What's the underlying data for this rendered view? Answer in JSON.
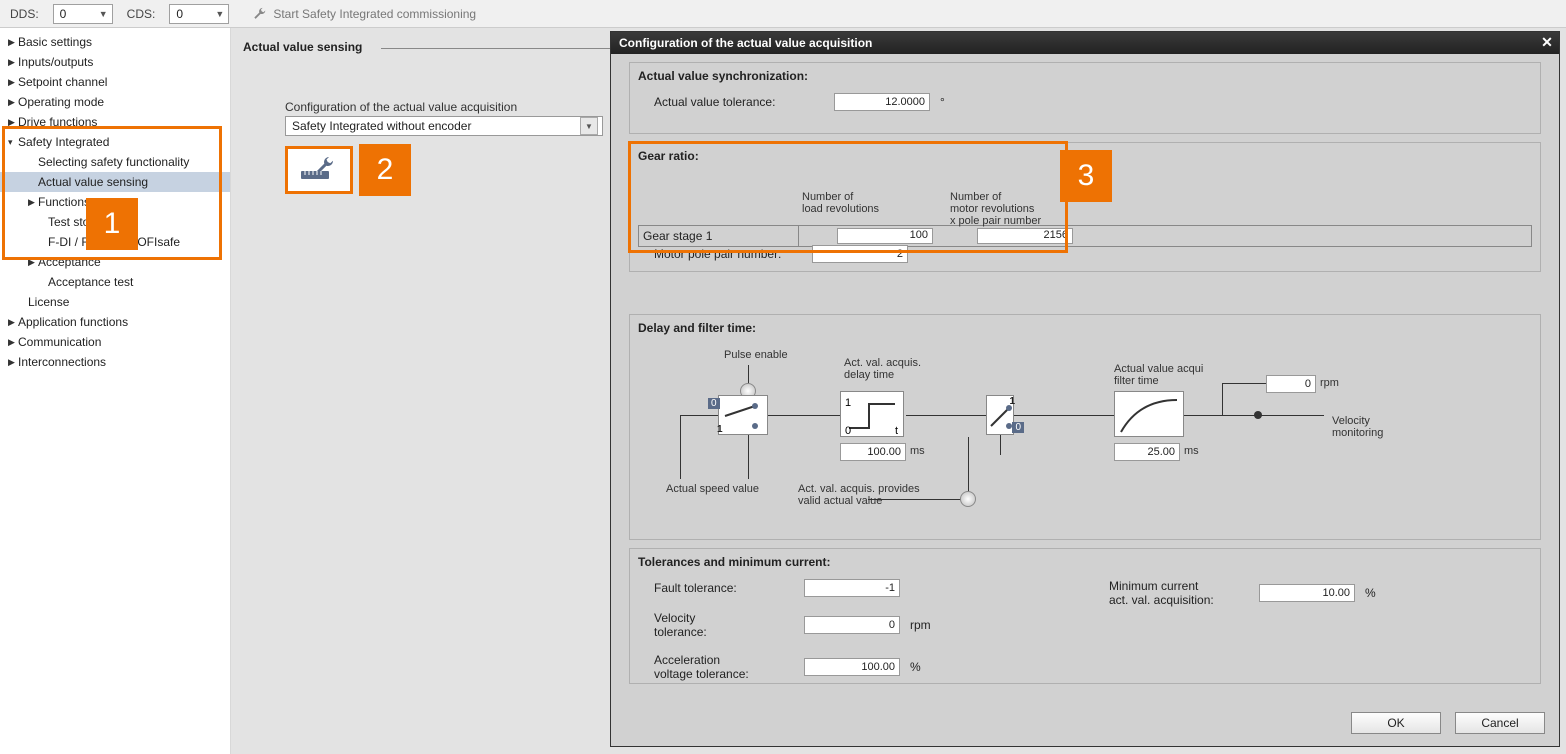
{
  "toolbar": {
    "dds_label": "DDS:",
    "dds_value": "0",
    "cds_label": "CDS:",
    "cds_value": "0",
    "commission": "Start Safety Integrated commissioning"
  },
  "nav": {
    "items": [
      {
        "label": "Basic settings",
        "expand": "▶"
      },
      {
        "label": "Inputs/outputs",
        "expand": "▶"
      },
      {
        "label": "Setpoint channel",
        "expand": "▶"
      },
      {
        "label": "Operating mode",
        "expand": "▶"
      },
      {
        "label": "Drive functions",
        "expand": "▶"
      },
      {
        "label": "Safety Integrated",
        "expand": "▾"
      },
      {
        "label": "Selecting safety functionality",
        "expand": ""
      },
      {
        "label": "Actual value sensing",
        "expand": ""
      },
      {
        "label": "Functions",
        "expand": "▶"
      },
      {
        "label": "Test stop",
        "expand": ""
      },
      {
        "label": "F-DI / F-DO / PROFIsafe",
        "expand": ""
      },
      {
        "label": "Acceptance",
        "expand": "▶"
      },
      {
        "label": "Acceptance test",
        "expand": ""
      },
      {
        "label": "License",
        "expand": ""
      },
      {
        "label": "Application functions",
        "expand": "▶"
      },
      {
        "label": "Communication",
        "expand": "▶"
      },
      {
        "label": "Interconnections",
        "expand": "▶"
      }
    ]
  },
  "center": {
    "title": "Actual value sensing",
    "cfg_label": "Configuration of the actual value acquisition",
    "cfg_value": "Safety Integrated without encoder"
  },
  "callouts": {
    "c1": "1",
    "c2": "2",
    "c3": "3"
  },
  "dialog": {
    "title": "Configuration of the actual value acquisition",
    "sync": {
      "title": "Actual value synchronization:",
      "tolerance_label": "Actual value tolerance:",
      "tolerance_value": "12.0000",
      "tolerance_unit": "°"
    },
    "gear": {
      "title": "Gear ratio:",
      "h_load": "Number of\nload revolutions",
      "h_motor": "Number of\nmotor revolutions\nx pole pair number",
      "row_label": "Gear stage 1",
      "load_val": "100",
      "motor_val": "2156",
      "pp_label": "Motor pole pair number:",
      "pp_val": "2"
    },
    "delay": {
      "title": "Delay and filter time:",
      "pulse_enable": "Pulse enable",
      "delay_label": "Act. val. acquis.\ndelay time",
      "delay_val": "100.00",
      "delay_unit": "ms",
      "filter_label": "Actual value acqui\nfilter time",
      "filter_val": "25.00",
      "filter_unit": "ms",
      "rpm_val": "0",
      "rpm_unit": "rpm",
      "speed_label": "Actual speed value",
      "valid_label": "Act. val. acquis. provides\nvalid actual value",
      "vel_mon": "Velocity\nmonitoring",
      "sw0": "0",
      "sw1": "1"
    },
    "tol": {
      "title": "Tolerances and minimum current:",
      "fault_label": "Fault tolerance:",
      "fault_val": "-1",
      "vel_label": "Velocity\ntolerance:",
      "vel_val": "0",
      "vel_unit": "rpm",
      "acc_label": "Acceleration\nvoltage tolerance:",
      "acc_val": "100.00",
      "acc_unit": "%",
      "min_label": "Minimum current\nact. val. acquisition:",
      "min_val": "10.00",
      "min_unit": "%"
    },
    "ok": "OK",
    "cancel": "Cancel"
  }
}
